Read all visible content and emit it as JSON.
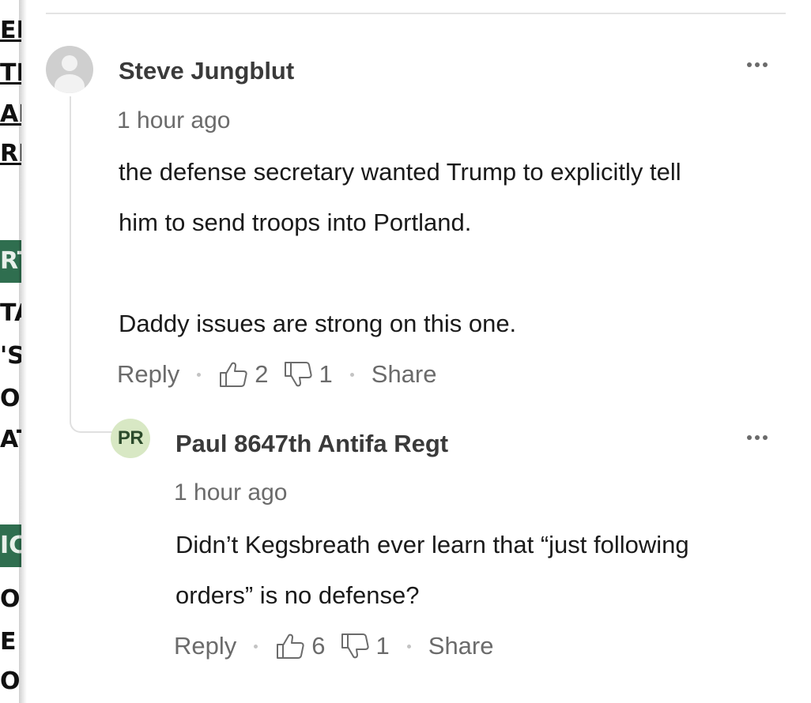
{
  "left_page": {
    "fragments": [
      "ER",
      "TI",
      "AN",
      "RI",
      "RT",
      "TA",
      "'S",
      "OU",
      "AT",
      "IC",
      "OR",
      "E",
      "OI"
    ]
  },
  "comments": [
    {
      "author": "Steve Jungblut",
      "time": "1 hour ago",
      "avatar": "generic-avatar",
      "lines": [
        "the defense secretary wanted Trump to explicitly tell",
        "him to send troops into Portland.",
        "Daddy issues are strong on this one."
      ],
      "reply_label": "Reply",
      "upvotes": "2",
      "downvotes": "1",
      "share_label": "Share"
    },
    {
      "author": "Paul 8647th Antifa Regt",
      "time": "1 hour ago",
      "avatar_initials": "PR",
      "avatar_color": "#d8e8c4",
      "lines": [
        "Didn’t Kegsbreath ever learn that “just following",
        "orders” is no defense?"
      ],
      "reply_label": "Reply",
      "upvotes": "6",
      "downvotes": "1",
      "share_label": "Share"
    }
  ],
  "icons": {
    "more": "more-options-icon",
    "upvote": "thumbs-up-icon",
    "downvote": "thumbs-down-icon"
  }
}
